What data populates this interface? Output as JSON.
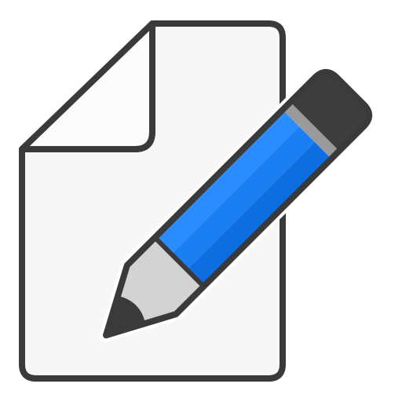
{
  "icon": {
    "name": "edit-document-icon",
    "colors": {
      "outline": "#3a3a3a",
      "document_fill": "#f7f7f7",
      "document_fold_fill": "#fbfbfb",
      "pencil_body_light": "#2b8cff",
      "pencil_body_mid": "#1a7ff2",
      "pencil_body_dark": "#0e6ee0",
      "pencil_eraser": "#3d3d3d",
      "pencil_ferrule": "#9a9a9a",
      "pencil_wood": "#d3d3d3",
      "pencil_lead": "#3a3a3a"
    }
  }
}
